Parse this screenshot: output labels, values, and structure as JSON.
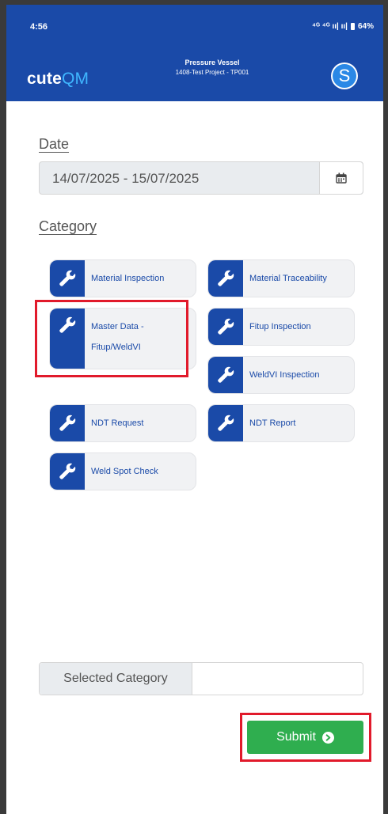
{
  "status_bar": {
    "time": "4:56",
    "indicators": "⁴ᴳ ⁴ᴳ ıı| ıı|",
    "battery": "64%"
  },
  "header": {
    "brand_part1": "cute",
    "brand_part2": "QM",
    "project_title": "Pressure Vessel",
    "project_subtitle": "1408-Test Project - TP001",
    "avatar_letter": "S"
  },
  "date_section": {
    "label": "Date",
    "value": "14/07/2025 - 15/07/2025",
    "calendar_icon": "calendar-icon"
  },
  "category_section": {
    "label": "Category",
    "items": [
      {
        "label": "Material Inspection",
        "icon": "wrench-icon"
      },
      {
        "label": "Material Traceability",
        "icon": "wrench-icon"
      },
      {
        "label_line1": "Master Data -",
        "label_line2": "Fitup/WeldVI",
        "icon": "wrench-icon"
      },
      {
        "label": "Fitup Inspection",
        "icon": "wrench-icon"
      },
      {
        "label": "WeldVI Inspection",
        "icon": "wrench-icon"
      },
      {
        "label": "NDT Request",
        "icon": "wrench-icon"
      },
      {
        "label": "NDT Report",
        "icon": "wrench-icon"
      },
      {
        "label": "Weld Spot Check",
        "icon": "wrench-icon"
      }
    ]
  },
  "selected_category": {
    "label": "Selected Category",
    "value": ""
  },
  "submit": {
    "label": "Submit",
    "icon": "arrow-right-circle-icon"
  },
  "colors": {
    "primary": "#1a4aa8",
    "accent": "#3fb6ff",
    "submit": "#2fae4f",
    "highlight": "#e11a2b"
  }
}
